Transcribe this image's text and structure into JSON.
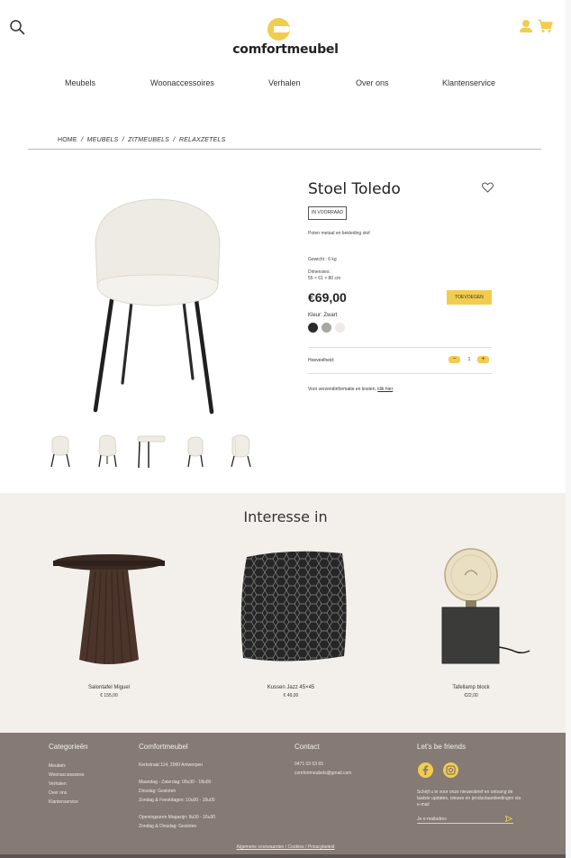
{
  "header": {
    "logo_text": "comfortmeubel",
    "nav": [
      "Meubels",
      "Woonaccessoires",
      "Verhalen",
      "Over ons",
      "Klantenservice"
    ]
  },
  "breadcrumb": {
    "home": "HOME",
    "sep": "/",
    "items": [
      "MEUBELS",
      "ZITMEUBELS",
      "RELAXZETELS"
    ]
  },
  "product": {
    "title": "Stoel Toledo",
    "stock": "IN VOORRAAD",
    "description": "Poten metaal en bekleding stof",
    "weight": "Gewicht : 6 kg",
    "dimensions_label": "Dimensies:",
    "dimensions": "55 × 61 × 80 cm",
    "price": "€69,00",
    "add_button": "TOEVOEGEN",
    "color_label": "Kleur: Zwart",
    "swatches": [
      "#2b2b2b",
      "#a9a7a2",
      "#eeebe6"
    ],
    "quantity_label": "Hoeveelheid:",
    "quantity": "1",
    "minus": "−",
    "plus": "+",
    "shipping_text": "Voor verzendinformatie en kosten,",
    "shipping_link": "klik hier"
  },
  "interest": {
    "title": "Interesse in",
    "items": [
      {
        "name": "Salontafel Miguel",
        "price": "€ 155,00"
      },
      {
        "name": "Kussen Jazz 45×45",
        "price": "€ 49,00"
      },
      {
        "name": "Tafellamp block",
        "price": "€22,00"
      }
    ]
  },
  "footer": {
    "categories_title": "Categorieën",
    "categories": [
      "Meubels",
      "Woonaccessoires",
      "Verhalen",
      "Over ons",
      "Klantenservice"
    ],
    "company_title": "Comfortmeubel",
    "address": "Kerkstraat 114, 2060 Antwerpen",
    "hours_1": "Maandag - Zaterdag: 09u30 - 18u00",
    "hours_2": "Dinsdag: Gesloten",
    "hours_3": "Zondag & Feestdagen: 10u00 - 18u00",
    "hours_4": "Openingsuren Magazijn: 9u30 - 16u30",
    "hours_5": "Zondag & Dinsdag: Gesloten",
    "contact_title": "Contact",
    "phone": "0471 03 53 65",
    "email": "comfortmeubels@gmail.com",
    "social_title": "Let's be friends",
    "newsletter_text": "Schrijf u in voor onze nieuwsbrief en ontvang de laatste updates, nieuws en productaanbiedingen via e-mail",
    "email_placeholder": "Je e-mailadres",
    "legal": "Algemene voorwaarden / Cookies / Privacybeleid"
  },
  "colors": {
    "accent": "#f2cc4f",
    "footer_bg": "#857a74",
    "interest_bg": "#f3f0ec"
  }
}
